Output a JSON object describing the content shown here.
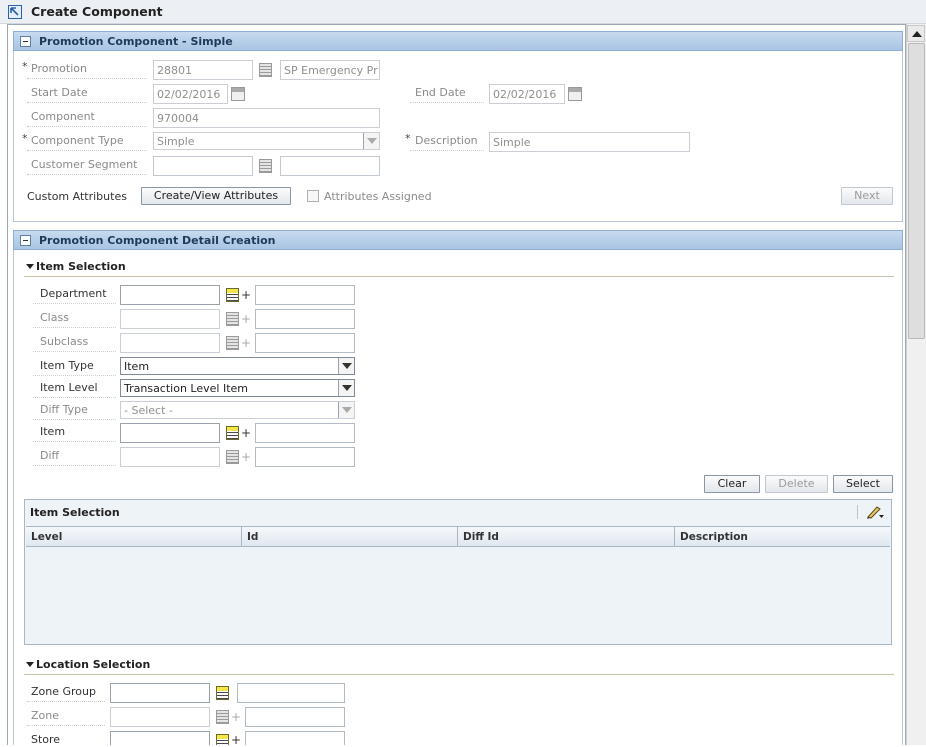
{
  "page": {
    "title": "Create Component"
  },
  "section1": {
    "title": "Promotion Component - Simple",
    "promotion": {
      "label": "Promotion",
      "value": "28801",
      "desc_value": "SP Emergency Pr"
    },
    "start_date": {
      "label": "Start Date",
      "value": "02/02/2016"
    },
    "end_date": {
      "label": "End Date",
      "value": "02/02/2016"
    },
    "component": {
      "label": "Component",
      "value": "970004"
    },
    "component_type": {
      "label": "Component Type",
      "value": "Simple"
    },
    "description": {
      "label": "Description",
      "value": "Simple"
    },
    "customer_segment": {
      "label": "Customer Segment",
      "value": "",
      "desc_value": ""
    },
    "custom_attributes": {
      "label": "Custom Attributes",
      "button": "Create/View Attributes",
      "checkbox_label": "Attributes Assigned"
    },
    "next_button": "Next",
    "required_mark": "*"
  },
  "section2": {
    "title": "Promotion Component Detail Creation",
    "item_selection": {
      "heading": "Item Selection",
      "department": {
        "label": "Department",
        "value": "",
        "desc_value": ""
      },
      "class": {
        "label": "Class",
        "value": "",
        "desc_value": ""
      },
      "subclass": {
        "label": "Subclass",
        "value": "",
        "desc_value": ""
      },
      "item_type": {
        "label": "Item Type",
        "value": "Item"
      },
      "item_level": {
        "label": "Item Level",
        "value": "Transaction Level Item"
      },
      "diff_type": {
        "label": "Diff Type",
        "value": "- Select -"
      },
      "item": {
        "label": "Item",
        "value": "",
        "desc_value": ""
      },
      "diff": {
        "label": "Diff",
        "value": "",
        "desc_value": ""
      },
      "buttons": {
        "clear": "Clear",
        "delete": "Delete",
        "select": "Select"
      },
      "plus": "+"
    },
    "item_table": {
      "title": "Item Selection",
      "columns": [
        "Level",
        "Id",
        "Diff Id",
        "Description"
      ],
      "rows": []
    },
    "location_selection": {
      "heading": "Location Selection",
      "zone_group": {
        "label": "Zone Group",
        "value": "",
        "desc_value": ""
      },
      "zone": {
        "label": "Zone",
        "value": "",
        "desc_value": ""
      },
      "store": {
        "label": "Store",
        "value": "",
        "desc_value": ""
      }
    }
  },
  "icons": {
    "back": "arrow-up-left-icon",
    "collapse": "minus-icon",
    "calendar": "calendar-icon",
    "lov": "list-icon",
    "edit": "pencil-icon"
  }
}
